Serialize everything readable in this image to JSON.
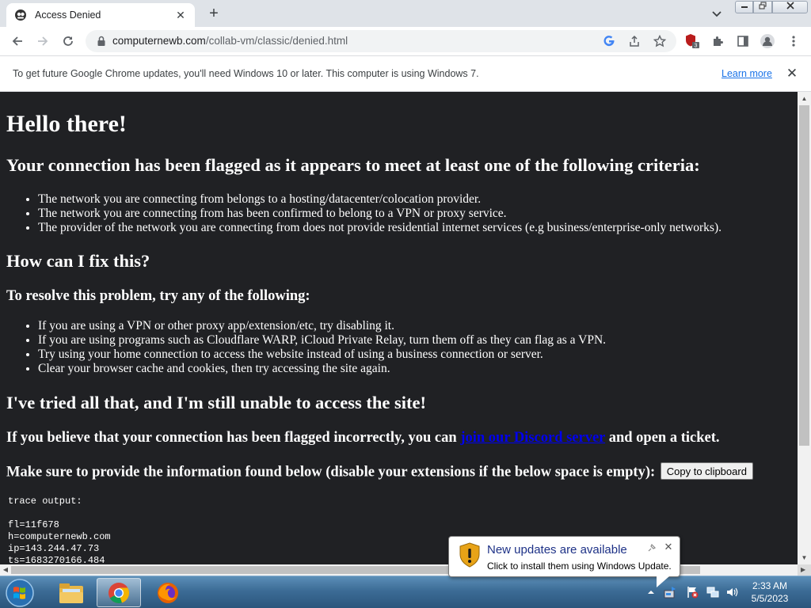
{
  "browser": {
    "tab_title": "Access Denied",
    "tab_close": "✕",
    "new_tab": "+",
    "url_domain": "computernewb.com",
    "url_path": "/collab-vm/classic/denied.html",
    "extension_badge": "3"
  },
  "infobar": {
    "message": "To get future Google Chrome updates, you'll need Windows 10 or later. This computer is using Windows 7.",
    "link": "Learn more",
    "close": "✕"
  },
  "page": {
    "heading": "Hello there!",
    "criteria_heading": "Your connection has been flagged as it appears to meet at least one of the following criteria:",
    "criteria": [
      "The network you are connecting from belongs to a hosting/datacenter/colocation provider.",
      "The network you are connecting from has been confirmed to belong to a VPN or proxy service.",
      "The provider of the network you are connecting from does not provide residential internet services (e.g business/enterprise-only networks)."
    ],
    "fix_heading": "How can I fix this?",
    "resolve_heading": "To resolve this problem, try any of the following:",
    "fixes": [
      "If you are using a VPN or other proxy app/extension/etc, try disabling it.",
      "If you are using programs such as Cloudflare WARP, iCloud Private Relay, turn them off as they can flag as a VPN.",
      "Try using your home connection to access the website instead of using a business connection or server.",
      "Clear your browser cache and cookies, then try accessing the site again."
    ],
    "tried_heading": "I've tried all that, and I'm still unable to access the site!",
    "flagged_prefix": "If you believe that your connection has been flagged incorrectly, you can ",
    "discord_link": "join our Discord server",
    "flagged_suffix": " and open a ticket.",
    "provide_text": "Make sure to provide the information found below (disable your extensions if the below space is empty):",
    "copy_button": "Copy to clipboard",
    "trace_label": "trace output:",
    "trace_lines": [
      "fl=11f678",
      "h=computernewb.com",
      "ip=143.244.47.73",
      "ts=1683270166.484"
    ]
  },
  "notification": {
    "title": "New updates are available",
    "text": "Click to install them using Windows Update.",
    "close": "✕"
  },
  "taskbar": {
    "time": "2:33 AM",
    "date": "5/5/2023"
  },
  "colors": {
    "page_bg": "#202124",
    "link": "#0000ee",
    "taskbar": "#3c6c96"
  }
}
